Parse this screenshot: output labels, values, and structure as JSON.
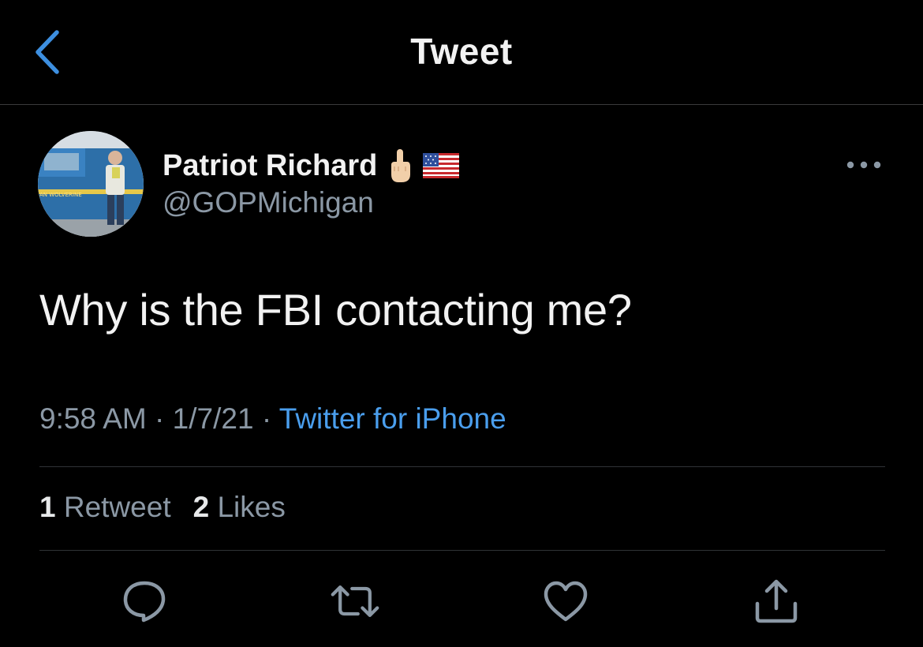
{
  "header": {
    "title": "Tweet",
    "back_icon": "chevron-left-icon",
    "accent_color": "#3d8fe0"
  },
  "author": {
    "display_name": "Patriot Richard",
    "handle": "@GOPMichigan",
    "name_emojis": [
      "middle-finger-emoji",
      "us-flag-emoji"
    ],
    "avatar_text": "AN WOLVERINE"
  },
  "tweet": {
    "text": "Why is the FBI contacting me?",
    "time": "9:58 AM",
    "date": "1/7/21",
    "separator": "·",
    "source": "Twitter for iPhone",
    "source_color": "#4a9eed"
  },
  "stats": {
    "retweet_count": "1",
    "retweet_label": "Retweet",
    "like_count": "2",
    "like_label": "Likes"
  },
  "actions": [
    "reply-icon",
    "retweet-icon",
    "like-icon",
    "share-icon"
  ]
}
